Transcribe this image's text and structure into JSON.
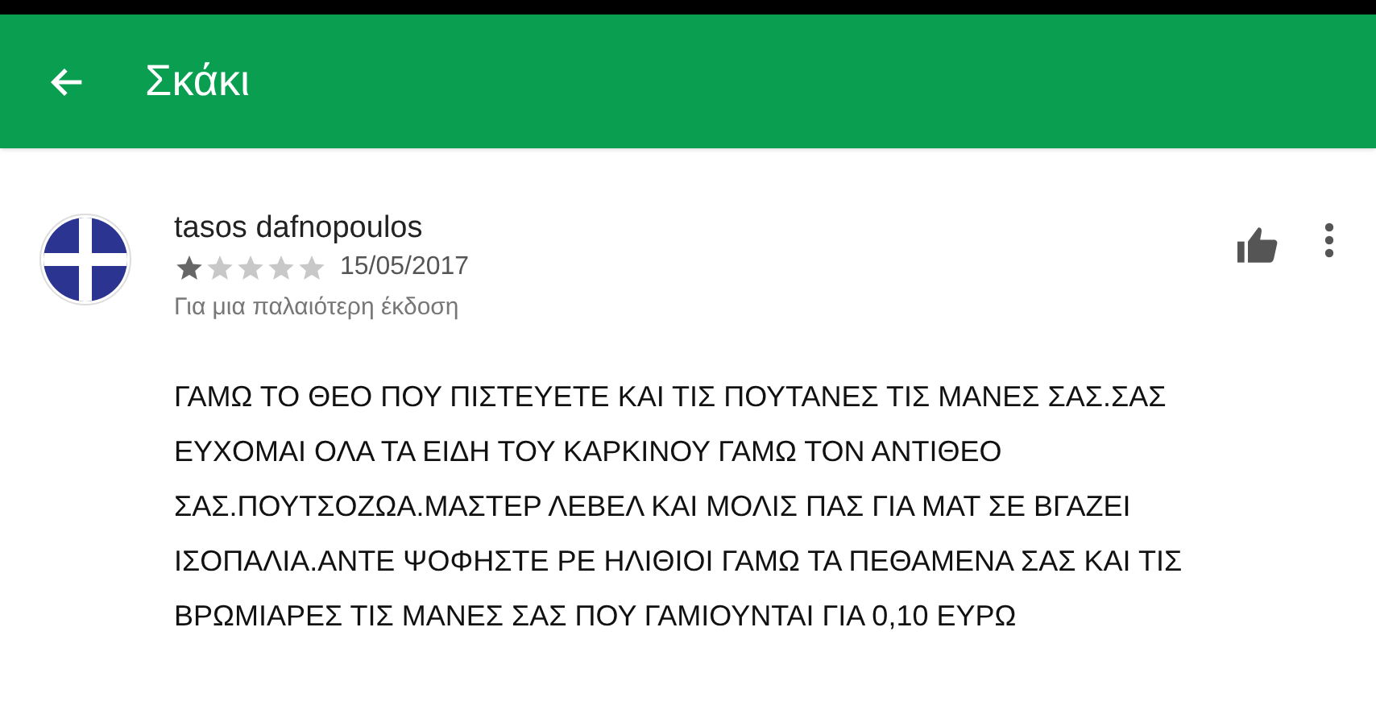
{
  "app_bar": {
    "title": "Σκάκι"
  },
  "review": {
    "author": "tasos dafnopoulos",
    "stars": 1,
    "date": "15/05/2017",
    "version_note": "Για μια παλαιότερη έκδοση",
    "body_lines": [
      "ΓΑΜΩ ΤΟ ΘΕΟ ΠΟΥ ΠΙΣΤΕΥΕΤΕ ΚΑΙ ΤΙΣ ΠΟΥΤΑΝΕΣ ΤΙΣ ΜΑΝΕΣ ΣΑΣ.ΣΑΣ",
      "ΕΥΧΟΜΑΙ ΟΛΑ ΤΑ ΕΙΔΗ ΤΟΥ ΚΑΡΚΙΝΟΥ ΓΑΜΩ ΤΟΝ ΑΝΤΙΘΕΟ",
      "ΣΑΣ.ΠΟΥΤΣΟΖΩΑ.ΜΑΣΤΕΡ ΛΕΒΕΛ ΚΑΙ ΜΟΛΙΣ ΠΑΣ ΓΙΑ ΜΑΤ ΣΕ ΒΓΑΖΕΙ",
      "ΙΣΟΠΑΛΙΑ.ΑΝΤΕ ΨΟΦΗΣΤΕ ΡΕ ΗΛΙΘΙΟΙ ΓΑΜΩ ΤΑ ΠΕΘΑΜΕΝΑ ΣΑΣ ΚΑΙ ΤΙΣ",
      "ΒΡΩΜΙΑΡΕΣ ΤΙΣ ΜΑΝΕΣ ΣΑΣ ΠΟΥ ΓΑΜΙΟΥΝΤΑΙ ΓΙΑ 0,10 ΕΥΡΩ"
    ]
  }
}
